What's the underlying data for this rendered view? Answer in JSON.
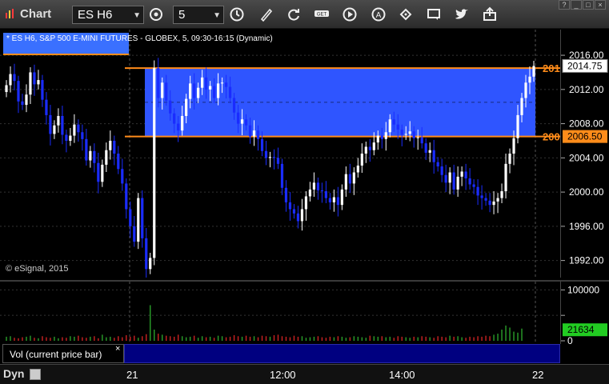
{
  "toolbar": {
    "title": "Chart",
    "symbol": "ES H6",
    "interval": "5",
    "icons": [
      "settings-icon",
      "clock-icon",
      "draw-icon",
      "refresh-icon",
      "quote-icon",
      "play-icon",
      "alert-icon",
      "tag-icon",
      "comment-icon",
      "twitter-icon",
      "share-icon"
    ]
  },
  "header": {
    "symbol_text": "* ES H6, S&P 500 E-MINI FUTURES - GLOBEX, 5, 09:30-16:15 (Dynamic)",
    "copyright": "© eSignal, 2015"
  },
  "price_axis": {
    "ticks": [
      "2016.00",
      "2012.00",
      "2008.00",
      "2004.00",
      "2000.00",
      "1996.00",
      "1992.00"
    ],
    "last_price": "2014.75",
    "lower_level": "2006.50",
    "upper_level_label": "201",
    "lower_level_label": "200"
  },
  "volume": {
    "label": "Vol (current price bar)",
    "close_symbol": "×",
    "ticks": [
      "100000",
      "50000",
      "0"
    ],
    "current": "21634"
  },
  "time_axis": {
    "mode": "Dyn",
    "ticks": [
      "21",
      "12:00",
      "14:00",
      "22"
    ]
  },
  "colors": {
    "zone": "#2f55ff",
    "level_line": "#ff8c1a",
    "up_candle": "#ffffff",
    "down_candle": "#1a2cff",
    "vol_up": "#2aa02a",
    "vol_down": "#cc2222",
    "current_vol": "#22cc22"
  },
  "chart_data": {
    "type": "candlestick",
    "ylim": [
      1990,
      2019
    ],
    "zone": [
      2006.5,
      2014.5
    ],
    "closes": [
      2012.5,
      2013.8,
      2013.0,
      2010.6,
      2010.2,
      2011.4,
      2014.0,
      2012.6,
      2013.1,
      2010.8,
      2009.0,
      2006.8,
      2007.8,
      2008.9,
      2006.7,
      2006.0,
      2006.6,
      2007.9,
      2007.0,
      2006.2,
      2003.7,
      2004.8,
      2003.4,
      2001.2,
      2003.2,
      2004.9,
      2006.0,
      2004.5,
      2002.7,
      2001.0,
      1998.0,
      1996.0,
      1994.2,
      1999.3,
      1994.6,
      1991.0,
      1992.3,
      2014.5,
      2011.0,
      2012.8,
      2010.7,
      2009.2,
      2008.0,
      2007.2,
      2008.9,
      2010.9,
      2012.7,
      2011.0,
      2012.2,
      2013.4,
      2012.0,
      2012.4,
      2011.0,
      2012.7,
      2012.8,
      2012.3,
      2011.0,
      2009.3,
      2008.0,
      2008.5,
      2007.8,
      2006.5,
      2007.2,
      2006.2,
      2004.8,
      2004.0,
      2004.1,
      2004.0,
      2003.3,
      2000.5,
      1998.8,
      1998.0,
      1997.5,
      1996.6,
      1998.0,
      1999.5,
      2000.3,
      2001.1,
      2000.2,
      2000.1,
      1999.3,
      1998.8,
      1999.4,
      1998.5,
      2000.3,
      2002.1,
      2001.0,
      2002.3,
      2003.1,
      2004.5,
      2005.3,
      2004.9,
      2005.8,
      2006.6,
      2006.2,
      2007.0,
      2008.5,
      2007.9,
      2007.3,
      2006.7,
      2006.8,
      2007.1,
      2006.3,
      2006.4,
      2005.7,
      2004.6,
      2004.9,
      2003.5,
      2003.0,
      2002.0,
      2001.1,
      2002.3,
      2000.3,
      2001.8,
      2002.4,
      2001.6,
      2000.9,
      2000.6,
      1999.6,
      1999.3,
      1999.0,
      1998.5,
      1998.9,
      1999.3,
      2000.1,
      2003.3,
      2004.5,
      2006.3,
      2009.0,
      2011.0,
      2012.8,
      2013.5,
      2014.75
    ],
    "volumes": [
      8,
      9,
      6,
      5,
      7,
      8,
      10,
      6,
      5,
      9,
      7,
      6,
      8,
      5,
      7,
      6,
      9,
      8,
      10,
      7,
      6,
      8,
      9,
      5,
      12,
      7,
      8,
      6,
      9,
      7,
      11,
      8,
      10,
      6,
      9,
      13,
      70,
      22,
      14,
      12,
      10,
      9,
      8,
      12,
      9,
      7,
      8,
      10,
      6,
      9,
      7,
      8,
      6,
      10,
      9,
      7,
      8,
      11,
      9,
      8,
      10,
      8,
      9,
      7,
      10,
      9,
      8,
      11,
      12,
      9,
      8,
      7,
      10,
      8,
      9,
      6,
      7,
      8,
      9,
      7,
      6,
      8,
      7,
      9,
      8,
      6,
      7,
      9,
      8,
      7,
      6,
      10,
      9,
      8,
      9,
      7,
      8,
      6,
      9,
      8,
      7,
      6,
      8,
      7,
      9,
      8,
      7,
      6,
      9,
      8,
      7,
      10,
      8,
      9,
      7,
      6,
      8,
      7,
      9,
      8,
      10,
      9,
      12,
      14,
      22,
      30,
      26,
      18,
      16,
      24
    ]
  }
}
